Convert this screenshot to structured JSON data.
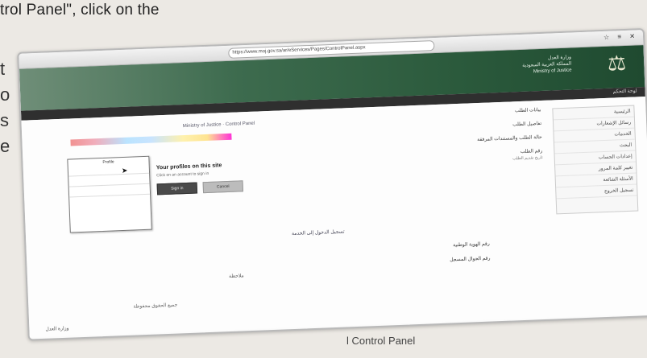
{
  "document": {
    "caption_top": "trol Panel\", click on the",
    "margin_letters": [
      "t",
      "o",
      "s",
      "e"
    ],
    "caption_bottom": "l Control Panel"
  },
  "browser": {
    "address": "https://www.moj.gov.sa/ar/eServices/Pages/ControlPanel.aspx",
    "icons": "☆ ≡ ✕"
  },
  "site": {
    "banner_lines": [
      "وزارة العدل",
      "المملكة العربية السعودية",
      "Ministry of Justice"
    ],
    "logo_glyph": "⚖",
    "nav_label": "لوحة التحكم"
  },
  "sidebar": {
    "items": [
      "الرئيسية",
      "رسائل الإشعارات",
      "الخدمات",
      "البحث",
      "إعدادات الحساب",
      "تغيير كلمة المرور",
      "الأسئلة الشائعة",
      "تسجيل الخروج"
    ]
  },
  "main": {
    "top_link": "Ministry of Justice · Control Panel",
    "lines": [
      {
        "text": "بيانات الطلب",
        "sub": ""
      },
      {
        "text": "تفاصيل الطلب",
        "sub": ""
      },
      {
        "text": "حالة الطلب والمستندات المرفقة",
        "sub": ""
      },
      {
        "text": "رقم الطلب",
        "sub": "تاريخ تقديم الطلب"
      }
    ]
  },
  "dialog": {
    "header": "Profile",
    "rows": [
      "",
      "",
      ""
    ]
  },
  "profile_prompt": {
    "title": "Your profiles on this site",
    "subtitle": "Click on an account to sign in",
    "primary_btn": "Sign in",
    "secondary_btn": "Cancel"
  },
  "lower": {
    "mid_link": "تسجيل الدخول إلى الخدمة",
    "rows": [
      "رقم الهوية الوطنية",
      "رقم الجوال المسجل"
    ],
    "note": "ملاحظة",
    "footer_mid": "جميع الحقوق محفوظة",
    "footer_left": "وزارة العدل"
  },
  "colors": {
    "banner_dark": "#1f4a30",
    "nav_bar": "#2f2f2f",
    "primary_btn": "#4a4a4a"
  }
}
